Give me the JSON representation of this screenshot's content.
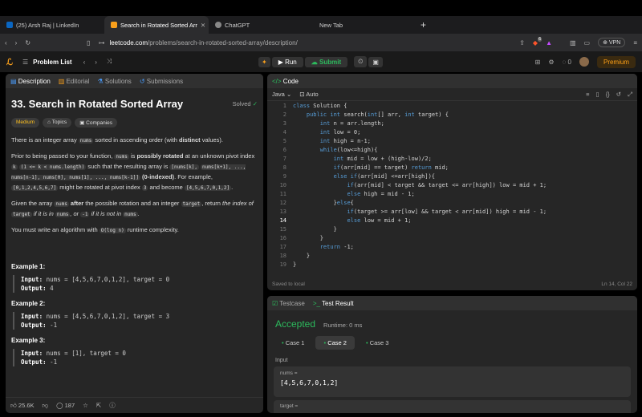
{
  "browser": {
    "tabs": [
      {
        "label": "(25) Arsh Raj | LinkedIn",
        "icon": "linkedin-icon",
        "color": "#0a66c2",
        "active": false
      },
      {
        "label": "Search in Rotated Sorted Arr",
        "icon": "leetcode-icon",
        "color": "#f89f1b",
        "active": true
      },
      {
        "label": "ChatGPT",
        "icon": "chatgpt-icon",
        "color": "#888888",
        "active": false
      },
      {
        "label": "New Tab",
        "icon": "",
        "color": "",
        "active": false
      }
    ],
    "new_tab": "+",
    "url_host": "leetcode.com",
    "url_path": "/problems/search-in-rotated-sorted-array/description/",
    "shield_count": "6",
    "vpn": "VPN"
  },
  "lc": {
    "problem_list": "Problem List",
    "run": "Run",
    "submit": "Submit",
    "coins": "0",
    "premium": "Premium"
  },
  "left": {
    "tabs": [
      "Description",
      "Editorial",
      "Solutions",
      "Submissions"
    ],
    "title": "33. Search in Rotated Sorted Array",
    "solved": "Solved",
    "difficulty": "Medium",
    "topics": "Topics",
    "companies": "Companies",
    "p1a": "There is an integer array ",
    "p1code": "nums",
    "p1b": " sorted in ascending order (with ",
    "p1bold": "distinct",
    "p1c": " values).",
    "p2a": "Prior to being passed to your function, ",
    "p2code1": "nums",
    "p2b": " is ",
    "p2bold": "possibly rotated",
    "p2c": " at an unknown pivot index ",
    "p2code2": "k",
    "p2code3": "(1 <= k < nums.length)",
    "p2d": " such that the resulting array is ",
    "p2code4": "[nums[k],",
    "p2code5": "nums[k+1], ..., nums[n-1], nums[0], nums[1], ..., nums[k-1]]",
    "p2bold2": "(0-indexed)",
    "p2e": ". For example, ",
    "p2code6": "[0,1,2,4,5,6,7]",
    "p2f": " might be rotated at pivot index ",
    "p2code7": "3",
    "p2g": " and become",
    "p2code8": "[4,5,6,7,0,1,2]",
    "p2h": ".",
    "p3a": "Given the array ",
    "p3code1": "nums",
    "p3bold": "after",
    "p3b": " the possible rotation and an integer ",
    "p3code2": "target",
    "p3c": ", return ",
    "p3i1": "the index of",
    "p3code3": "target",
    "p3i2": " if it is in ",
    "p3code4": "nums",
    "p3i3": ", or ",
    "p3code5": "-1",
    "p3i4": " if it is not in ",
    "p3code6": "nums",
    "p3d": ".",
    "p4a": "You must write an algorithm with ",
    "p4code": "O(log n)",
    "p4b": " runtime complexity.",
    "examples": [
      {
        "h": "Example 1:",
        "in": "nums = [4,5,6,7,0,1,2], target = 0",
        "out": "4"
      },
      {
        "h": "Example 2:",
        "in": "nums = [4,5,6,7,0,1,2], target = 3",
        "out": "-1"
      },
      {
        "h": "Example 3:",
        "in": "nums = [1], target = 0",
        "out": "-1"
      }
    ],
    "input_label": "Input:",
    "output_label": "Output:",
    "likes": "25.6K",
    "comments": "187"
  },
  "code": {
    "title": "Code",
    "lang": "Java",
    "auto": "Auto",
    "lines": [
      "class Solution {",
      "    public int search(int[] arr, int target) {",
      "        int n = arr.length;",
      "        int low = 0;",
      "        int high = n-1;",
      "        while(low<=high){",
      "            int mid = low + (high-low)/2;",
      "            if(arr[mid] == target) return mid;",
      "            else if(arr[mid] <=arr[high]){",
      "                if(arr[mid] < target && target <= arr[high]) low = mid + 1;",
      "                else high = mid - 1;",
      "            }else{",
      "                if(target >= arr[low] && target < arr[mid]) high = mid - 1;",
      "                else low = mid + 1;",
      "            }",
      "        }",
      "        return -1;",
      "    }",
      "}"
    ],
    "saved": "Saved to local",
    "cursor": "Ln 14, Col 22"
  },
  "test": {
    "tab1": "Testcase",
    "tab2": "Test Result",
    "status": "Accepted",
    "runtime": "Runtime: 0 ms",
    "cases": [
      "Case 1",
      "Case 2",
      "Case 3"
    ],
    "active_case": 1,
    "input_label": "Input",
    "var1": "nums =",
    "val1": "[4,5,6,7,0,1,2]",
    "var2": "target ="
  },
  "colors": {
    "accent": "#f89f1b",
    "green": "#2cbb5d",
    "difficulty": "#ffc01e"
  }
}
